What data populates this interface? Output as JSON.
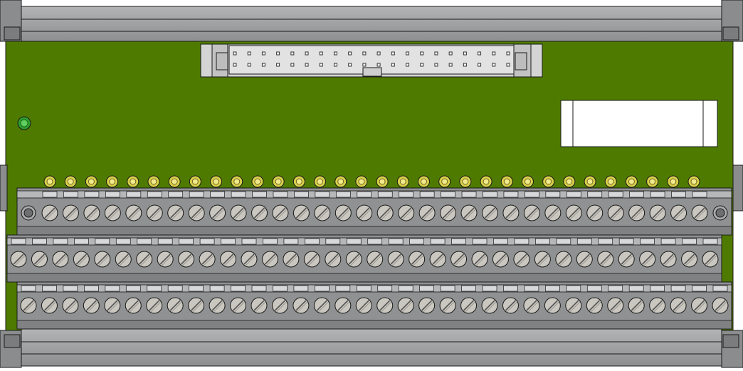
{
  "device": {
    "name": "",
    "label_text": ""
  },
  "colors": {
    "pcb": "#4f7a00",
    "rail": "#9a9c9d",
    "rail_dark": "#6f7172",
    "block": "#8f9192",
    "block_top": "#b5b7b8",
    "screw": "#c9c7bf",
    "pin": "#d9cf4a",
    "led": "#34b034",
    "connector": "#d4d4d4",
    "outline": "#1a1a1a"
  },
  "header": {
    "pin_pairs": 20
  },
  "test_points": {
    "count": 32
  },
  "terminal_rows": [
    {
      "id": "row-1",
      "screws": 32
    },
    {
      "id": "row-2",
      "screws": 34
    },
    {
      "id": "row-3",
      "screws": 34
    }
  ]
}
